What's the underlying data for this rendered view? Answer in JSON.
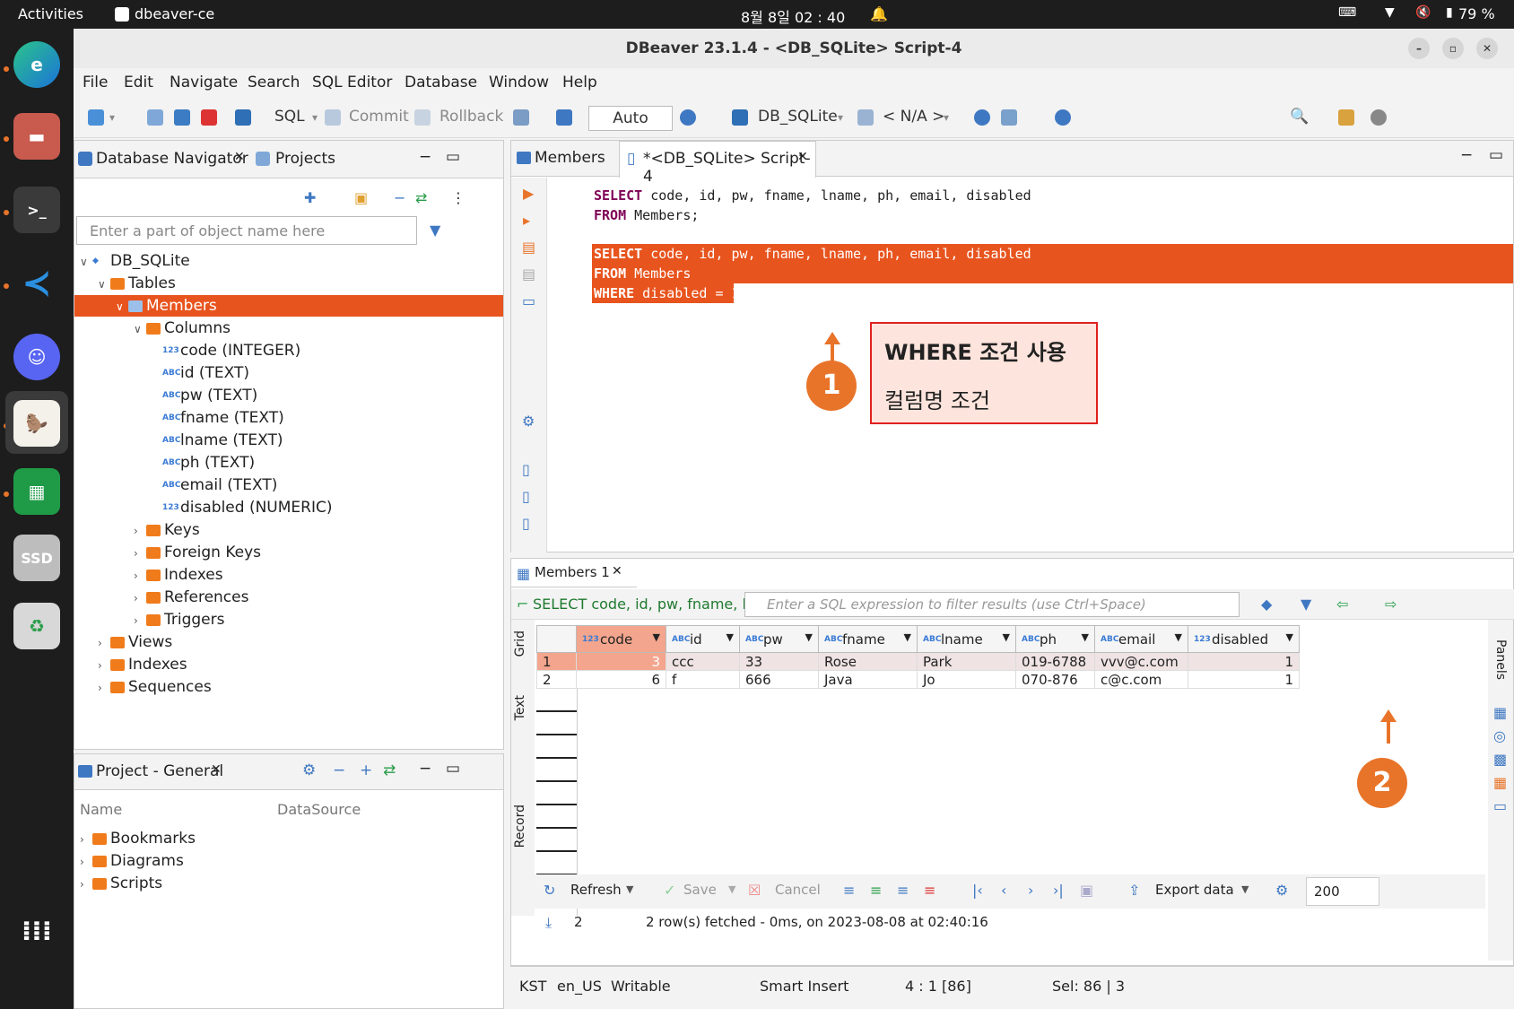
{
  "topbar": {
    "activities": "Activities",
    "app": "dbeaver-ce",
    "clock": "8월 8일  02 : 40",
    "battery": "79 %"
  },
  "dock": {
    "ssd_label": "SSD"
  },
  "window": {
    "title": "DBeaver 23.1.4 - <DB_SQLite> Script-4"
  },
  "menu": [
    "File",
    "Edit",
    "Navigate",
    "Search",
    "SQL Editor",
    "Database",
    "Window",
    "Help"
  ],
  "toolbar": {
    "sql": "SQL",
    "commit": "Commit",
    "rollback": "Rollback",
    "auto": "Auto",
    "datasource": "DB_SQLite",
    "schema": "< N/A >"
  },
  "navigator": {
    "tab_db": "Database Navigator",
    "tab_projects": "Projects",
    "filter_placeholder": "Enter a part of object name here",
    "tree": {
      "db": "DB_SQLite",
      "tables": "Tables",
      "members": "Members",
      "columns": "Columns",
      "cols": [
        {
          "type": "123",
          "label": "code (INTEGER)"
        },
        {
          "type": "ABC",
          "label": "id (TEXT)"
        },
        {
          "type": "ABC",
          "label": "pw (TEXT)"
        },
        {
          "type": "ABC",
          "label": "fname (TEXT)"
        },
        {
          "type": "ABC",
          "label": "lname (TEXT)"
        },
        {
          "type": "ABC",
          "label": "ph (TEXT)"
        },
        {
          "type": "ABC",
          "label": "email (TEXT)"
        },
        {
          "type": "123",
          "label": "disabled (NUMERIC)"
        }
      ],
      "keys": "Keys",
      "foreign_keys": "Foreign Keys",
      "indexes": "Indexes",
      "references": "References",
      "triggers": "Triggers",
      "views": "Views",
      "indexes2": "Indexes",
      "sequences": "Sequences"
    }
  },
  "project": {
    "tab": "Project - General",
    "col_name": "Name",
    "col_ds": "DataSource",
    "items": [
      "Bookmarks",
      "Diagrams",
      "Scripts"
    ]
  },
  "editor": {
    "tab_members": "Members",
    "tab_script": "*<DB_SQLite> Script-4",
    "line1_kw": "SELECT",
    "line1_rest": " code, id, pw, fname, lname, ph, email, disabled",
    "line2_kw": "FROM",
    "line2_rest": " Members;",
    "line3_kw": "SELECT",
    "line3_rest": " code, id, pw, fname, lname, ph, email, disabled",
    "line4_kw": "FROM",
    "line4_rest": " Members",
    "line5_kw": "WHERE",
    "line5_rest": " disabled = 1"
  },
  "annotation": {
    "title": "WHERE 조건 사용",
    "body": "컬럼명 조건",
    "num1": "1",
    "num2": "2",
    "accent": "#e8742a"
  },
  "results": {
    "tab": "Members 1",
    "query_text": "SELECT code, id, pw, fname, lna",
    "filter_placeholder": "Enter a SQL expression to filter results (use Ctrl+Space)",
    "side_grid": "Grid",
    "side_text": "Text",
    "side_record": "Record",
    "side_panels": "Panels",
    "columns": [
      {
        "type": "123",
        "name": "code"
      },
      {
        "type": "ABC",
        "name": "id"
      },
      {
        "type": "ABC",
        "name": "pw"
      },
      {
        "type": "ABC",
        "name": "fname"
      },
      {
        "type": "ABC",
        "name": "lname"
      },
      {
        "type": "ABC",
        "name": "ph"
      },
      {
        "type": "ABC",
        "name": "email"
      },
      {
        "type": "123",
        "name": "disabled"
      }
    ],
    "rows": [
      {
        "n": "1",
        "code": "3",
        "id": "ccc",
        "pw": "33",
        "fname": "Rose",
        "lname": "Park",
        "ph": "019-6788",
        "email": "vvv@c.com",
        "disabled": "1"
      },
      {
        "n": "2",
        "code": "6",
        "id": "f",
        "pw": "666",
        "fname": "Java",
        "lname": "Jo",
        "ph": "070-876",
        "email": "c@c.com",
        "disabled": "1"
      }
    ],
    "refresh": "Refresh",
    "save": "Save",
    "cancel": "Cancel",
    "export": "Export data",
    "fetch_size": "200",
    "row_count": "2",
    "status": "2 row(s) fetched - 0ms, on 2023-08-08 at 02:40:16"
  },
  "statusbar": {
    "tz": "KST",
    "locale": "en_US",
    "mode": "Writable",
    "insert": "Smart Insert",
    "pos": "4 : 1 [86]",
    "sel": "Sel: 86 | 3"
  }
}
